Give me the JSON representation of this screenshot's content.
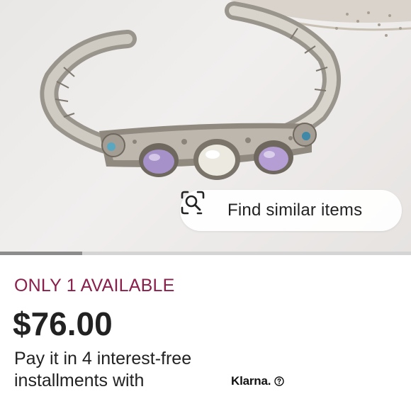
{
  "find_similar": {
    "label": "Find similar items",
    "icon": "visual-search-icon"
  },
  "gallery": {
    "progress_fraction": 0.2
  },
  "listing": {
    "availability": "ONLY 1 AVAILABLE",
    "price": "$76.00",
    "installments_text": "Pay it in 4 interest-free installments with",
    "klarna_brand": "Klarna.",
    "klarna_info_icon": "info-circle-icon"
  },
  "colors": {
    "availability": "#8a1f4c",
    "text": "#222222",
    "progress_fill": "#8c8c8c",
    "progress_track": "#d4d4d4"
  }
}
